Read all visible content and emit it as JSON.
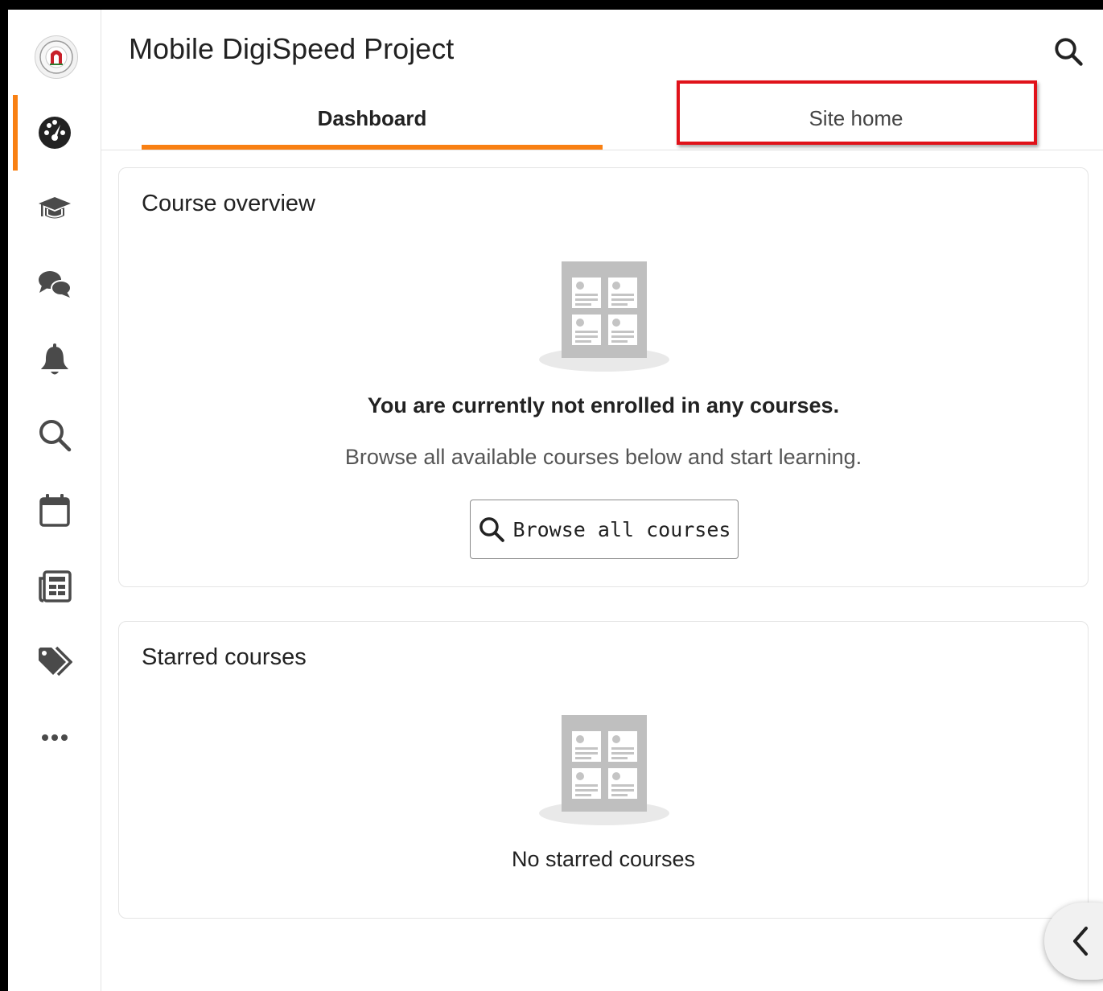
{
  "header": {
    "title": "Mobile DigiSpeed Project",
    "search_icon": "search-icon"
  },
  "tabs": [
    {
      "label": "Dashboard",
      "active": true
    },
    {
      "label": "Site home",
      "active": false,
      "highlighted": true
    }
  ],
  "rail": {
    "logo": "university-seal",
    "items": [
      {
        "icon": "dashboard-icon",
        "active": true
      },
      {
        "icon": "graduation-cap-icon"
      },
      {
        "icon": "messages-icon"
      },
      {
        "icon": "bell-icon"
      },
      {
        "icon": "search-icon"
      },
      {
        "icon": "calendar-icon"
      },
      {
        "icon": "newspaper-icon"
      },
      {
        "icon": "tags-icon"
      },
      {
        "icon": "more-icon"
      }
    ]
  },
  "course_overview": {
    "title": "Course overview",
    "empty_title": "You are currently not enrolled in any courses.",
    "empty_text": "Browse all available courses below and start learning.",
    "button_label": "Browse all courses"
  },
  "starred": {
    "title": "Starred courses",
    "empty_text": "No starred courses"
  },
  "colors": {
    "accent": "#f98012",
    "highlight": "#e0121a"
  }
}
